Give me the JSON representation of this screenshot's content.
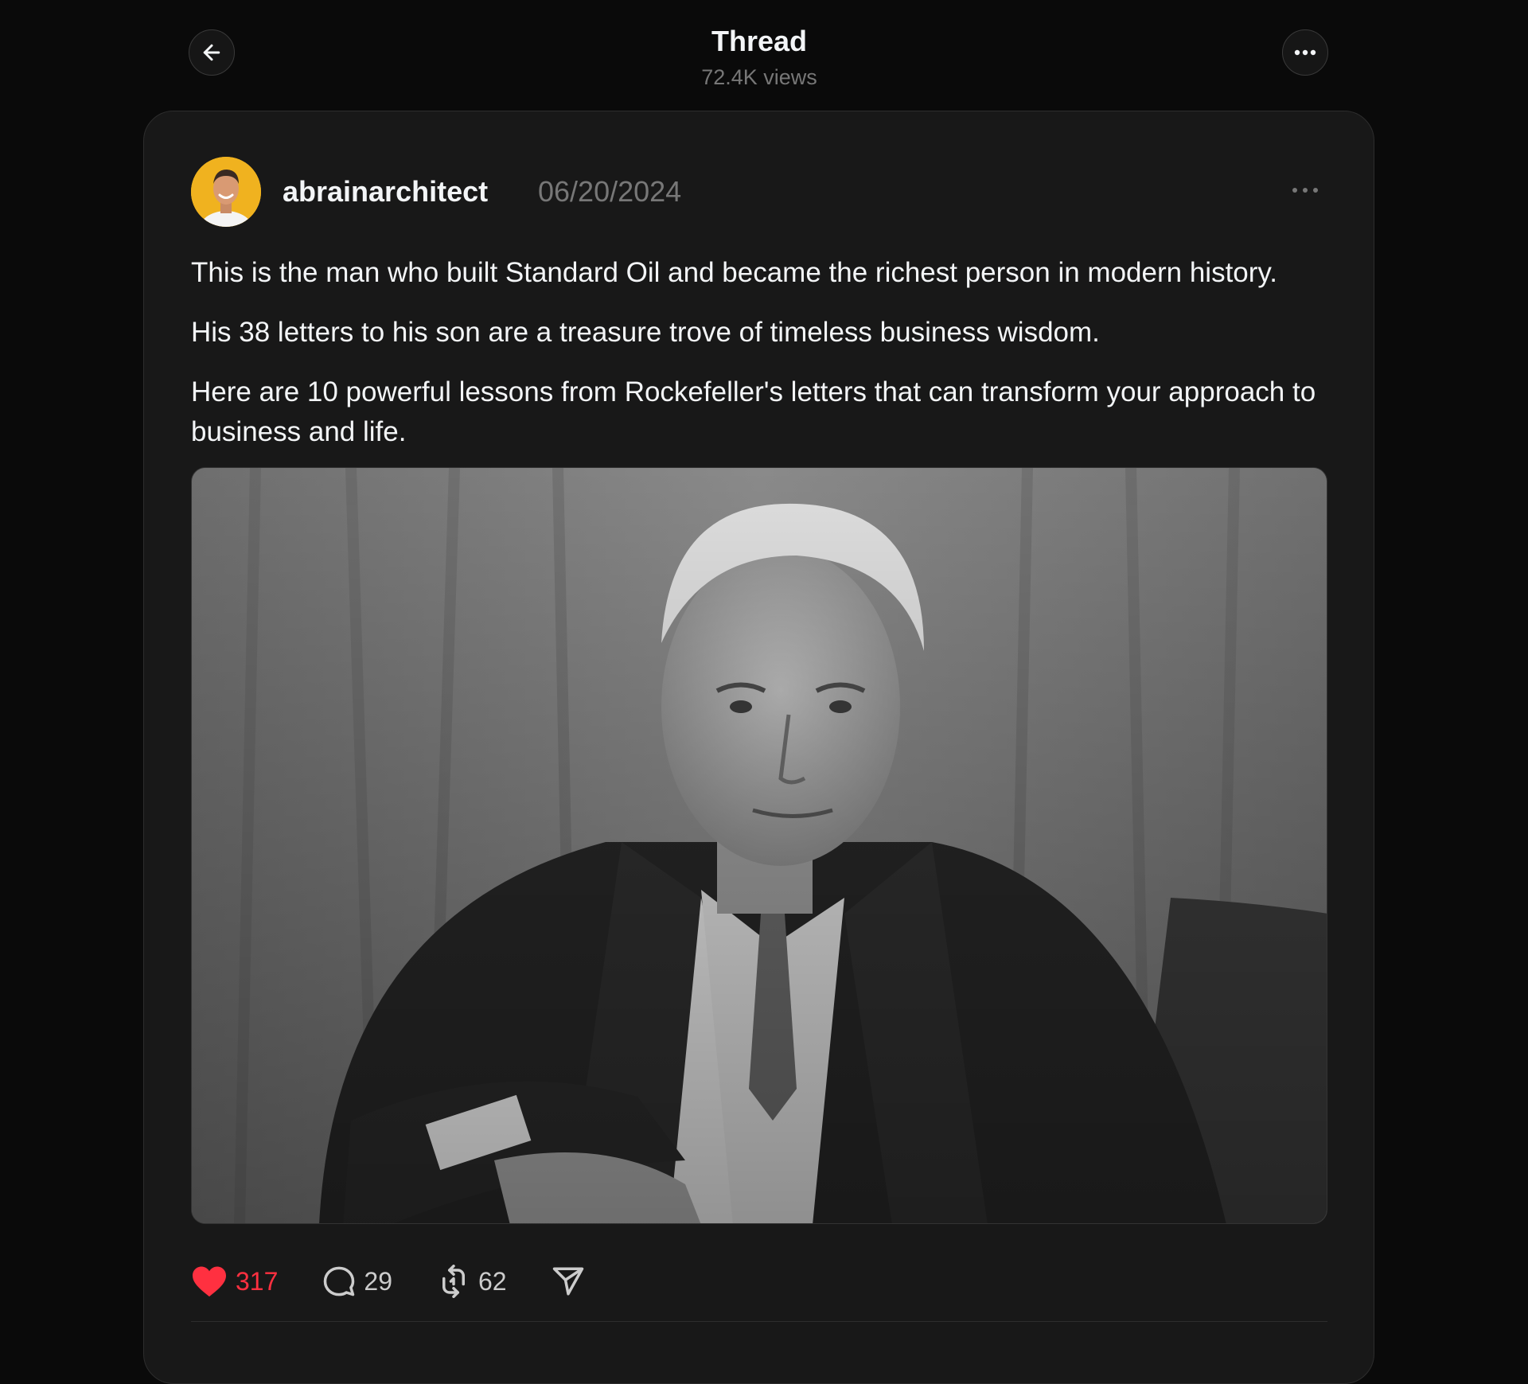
{
  "header": {
    "title": "Thread",
    "views": "72.4K views",
    "back_icon": "arrow-left-icon",
    "more_icon": "more-horizontal-icon"
  },
  "post": {
    "username": "abrainarchitect",
    "date": "06/20/2024",
    "paragraphs": [
      "This is the man who built Standard Oil and became the richest person in modern history.",
      "His 38 letters to his son are a treasure trove of timeless business wisdom.",
      "Here are 10 powerful lessons from Rockefeller's letters that can transform your approach to business and life."
    ],
    "actions": {
      "likes": "317",
      "comments": "29",
      "reposts": "62"
    }
  },
  "colors": {
    "background": "#0a0a0a",
    "card": "#181818",
    "text": "#f3f5f7",
    "muted": "#777777",
    "like": "#ff3040",
    "avatar_bg": "#f0b21f"
  }
}
